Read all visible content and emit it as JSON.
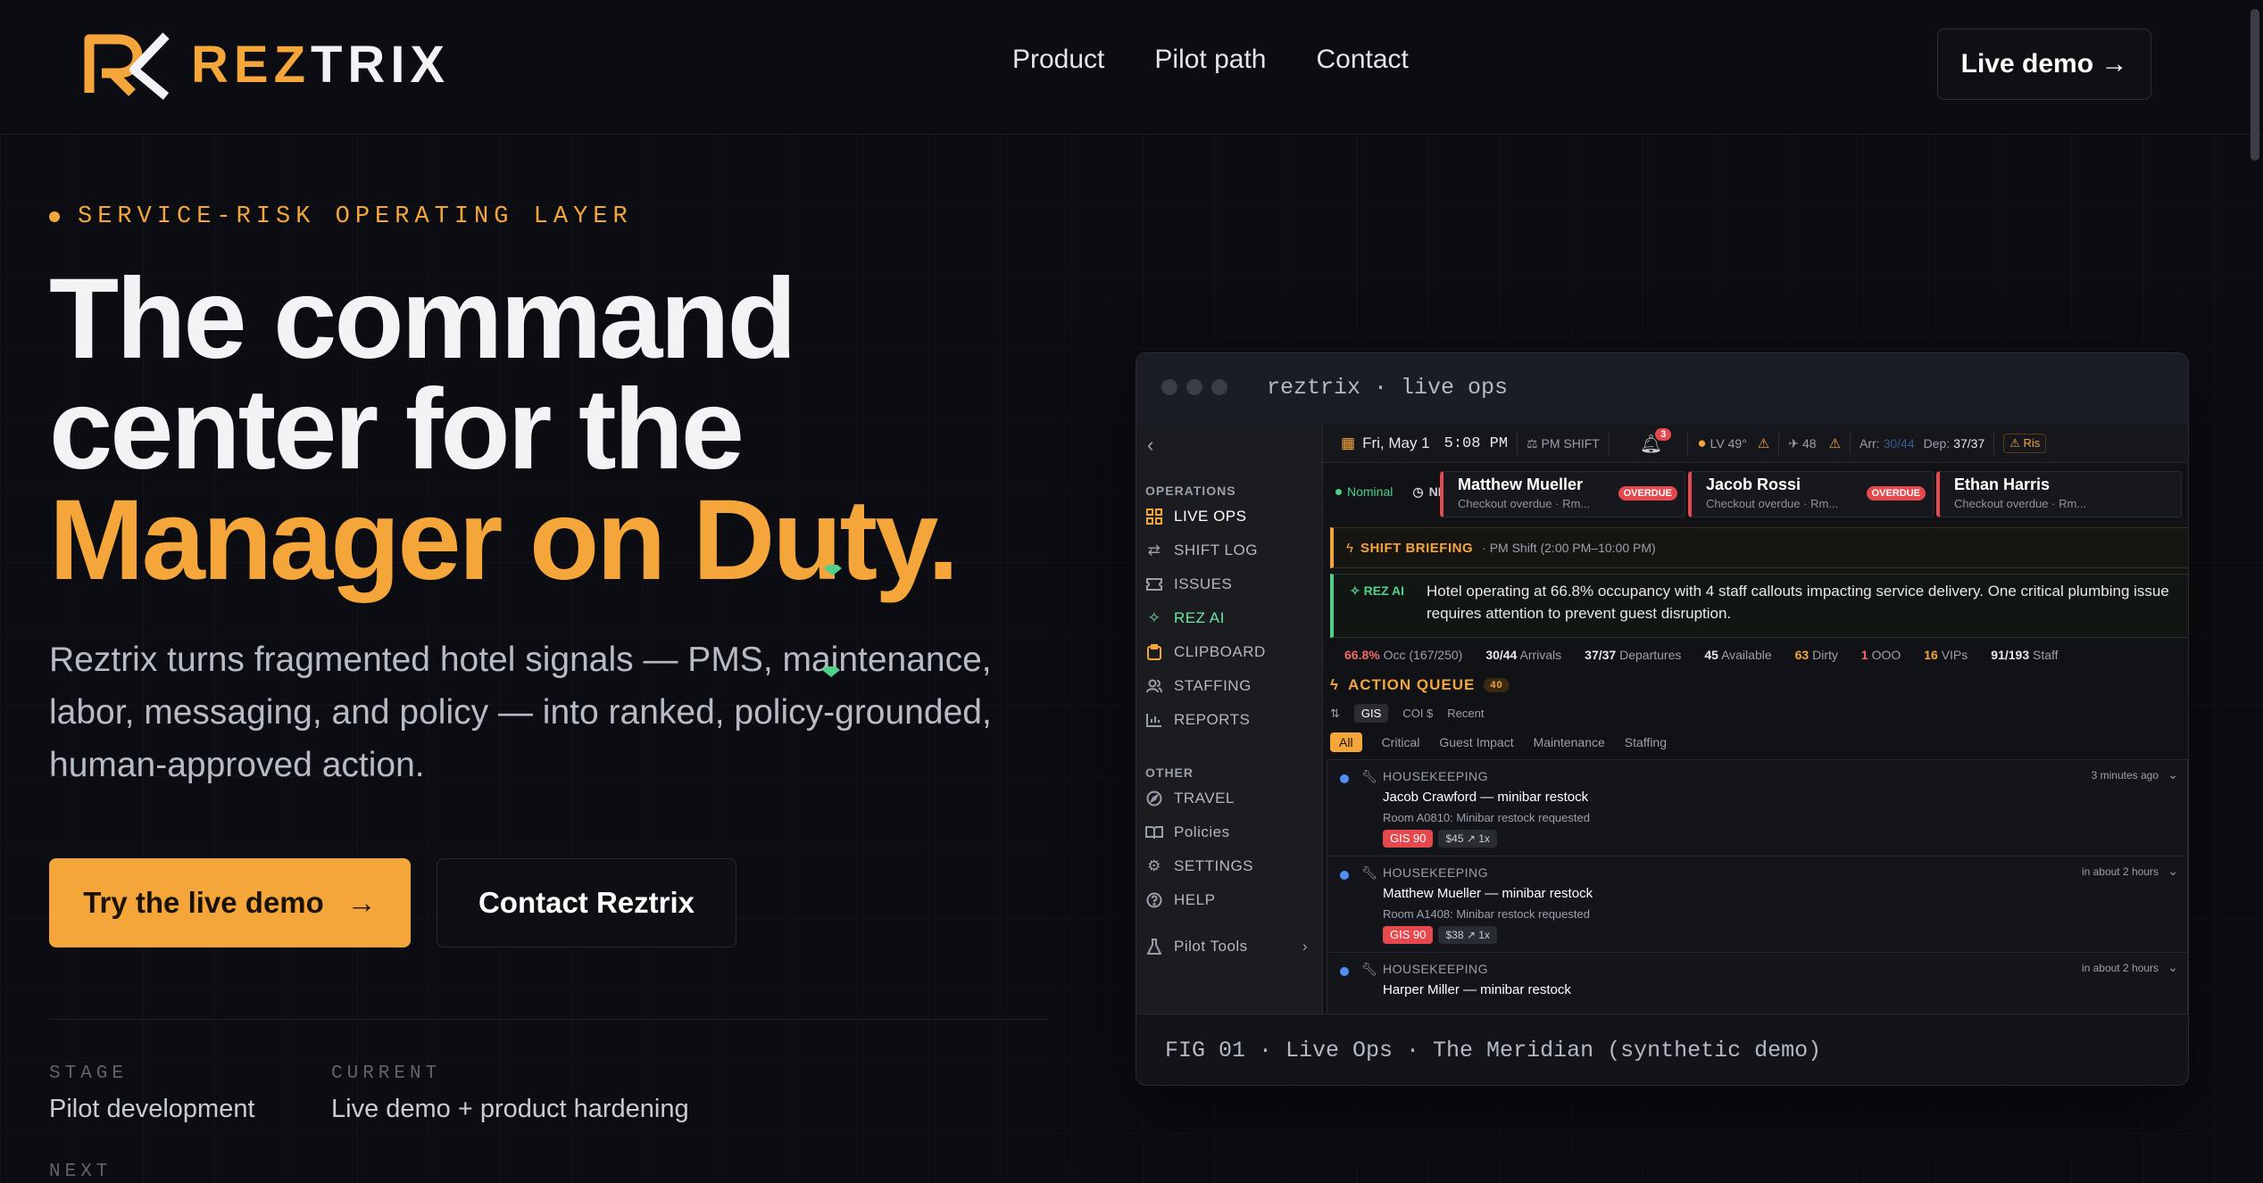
{
  "brand": {
    "name_part1": "REZ",
    "name_part2": "TRIX",
    "accent": "#f4a63a"
  },
  "nav": {
    "links": [
      "Product",
      "Pilot path",
      "Contact"
    ],
    "cta": "Live demo →"
  },
  "hero": {
    "eyebrow": "SERVICE-RISK OPERATING LAYER",
    "headline_line1": "The command",
    "headline_line2": "center for the",
    "headline_line3": "Manager on Duty.",
    "subhead": "Reztrix turns fragmented hotel signals — PMS, maintenance, labor, messaging, and policy — into ranked, policy-grounded, human-approved action.",
    "cta_primary": "Try the live demo",
    "cta_primary_arrow": "→",
    "cta_secondary": "Contact Reztrix",
    "stats": [
      {
        "label": "STAGE",
        "value": "Pilot development"
      },
      {
        "label": "CURRENT",
        "value": "Live demo + product hardening"
      },
      {
        "label": "NEXT",
        "value": ""
      }
    ]
  },
  "app_window": {
    "title": "reztrix · live ops",
    "caption": "FIG 01 · Live Ops · The Meridian (synthetic demo)",
    "sidebar": {
      "section_operations": "OPERATIONS",
      "items_operations": [
        {
          "label": "LIVE OPS",
          "icon": "grid-icon"
        },
        {
          "label": "SHIFT LOG",
          "icon": "swap-arrows-icon"
        },
        {
          "label": "ISSUES",
          "icon": "ticket-icon"
        },
        {
          "label": "REZ AI",
          "icon": "sparkle-icon"
        },
        {
          "label": "CLIPBOARD",
          "icon": "clipboard-icon"
        },
        {
          "label": "STAFFING",
          "icon": "people-icon"
        },
        {
          "label": "REPORTS",
          "icon": "bar-chart-icon"
        }
      ],
      "section_other": "OTHER",
      "items_other": [
        {
          "label": "TRAVEL",
          "icon": "compass-icon"
        },
        {
          "label": "Policies",
          "icon": "book-icon"
        },
        {
          "label": "SETTINGS",
          "icon": "gear-icon"
        },
        {
          "label": "HELP",
          "icon": "help-icon"
        },
        {
          "label": "Pilot Tools",
          "icon": "flask-icon"
        }
      ]
    },
    "topbar": {
      "date": "Fri, May 1",
      "time": "5:08 PM",
      "shift": "PM SHIFT",
      "notifications": "3",
      "weather": "LV 49°",
      "flights": "48",
      "arr_label": "Arr:",
      "arr_value": "30/44",
      "dep_label": "Dep:",
      "dep_value": "37/37",
      "risk": "Ris"
    },
    "status": {
      "nominal": "Nominal",
      "next_up": "NEXT UP",
      "guests": [
        {
          "name": "Matthew Mueller",
          "sub": "Checkout overdue · Rm...",
          "badge": "OVERDUE"
        },
        {
          "name": "Jacob Rossi",
          "sub": "Checkout overdue · Rm...",
          "badge": "OVERDUE"
        },
        {
          "name": "Ethan Harris",
          "sub": "Checkout overdue · Rm...",
          "badge": ""
        }
      ]
    },
    "briefing": {
      "label": "SHIFT BRIEFING",
      "text": "PM Shift (2:00 PM–10:00 PM)"
    },
    "rez_ai": {
      "label": "REZ AI",
      "text": "Hotel operating at 66.8% occupancy with 4 staff callouts impacting service delivery. One critical plumbing issue requires attention to prevent guest disruption."
    },
    "metrics": [
      {
        "value": "66.8%",
        "label": "Occ (167/250)",
        "tone": "rd"
      },
      {
        "value": "30/44",
        "label": "Arrivals",
        "tone": ""
      },
      {
        "value": "37/37",
        "label": "Departures",
        "tone": ""
      },
      {
        "value": "45",
        "label": "Available",
        "tone": ""
      },
      {
        "value": "63",
        "label": "Dirty",
        "tone": "or"
      },
      {
        "value": "1",
        "label": "OOO",
        "tone": "rd"
      },
      {
        "value": "16",
        "label": "VIPs",
        "tone": "or"
      },
      {
        "value": "91/193",
        "label": "Staff",
        "tone": ""
      }
    ],
    "action_queue": {
      "title": "ACTION QUEUE",
      "count": "40",
      "sort_options": [
        "GIS",
        "COI $",
        "Recent"
      ],
      "filters": [
        "All",
        "Critical",
        "Guest Impact",
        "Maintenance",
        "Staffing"
      ],
      "items": [
        {
          "category": "HOUSEKEEPING",
          "time": "3 minutes ago",
          "title": "Jacob Crawford — minibar restock",
          "desc": "Room A0810: Minibar restock requested",
          "gis": "GIS 90",
          "cost": "$45 ↗ 1x"
        },
        {
          "category": "HOUSEKEEPING",
          "time": "in about 2 hours",
          "title": "Matthew Mueller — minibar restock",
          "desc": "Room A1408: Minibar restock requested",
          "gis": "GIS 90",
          "cost": "$38 ↗ 1x"
        },
        {
          "category": "HOUSEKEEPING",
          "time": "in about 2 hours",
          "title": "Harper Miller — minibar restock",
          "desc": "",
          "gis": "",
          "cost": ""
        }
      ]
    }
  }
}
